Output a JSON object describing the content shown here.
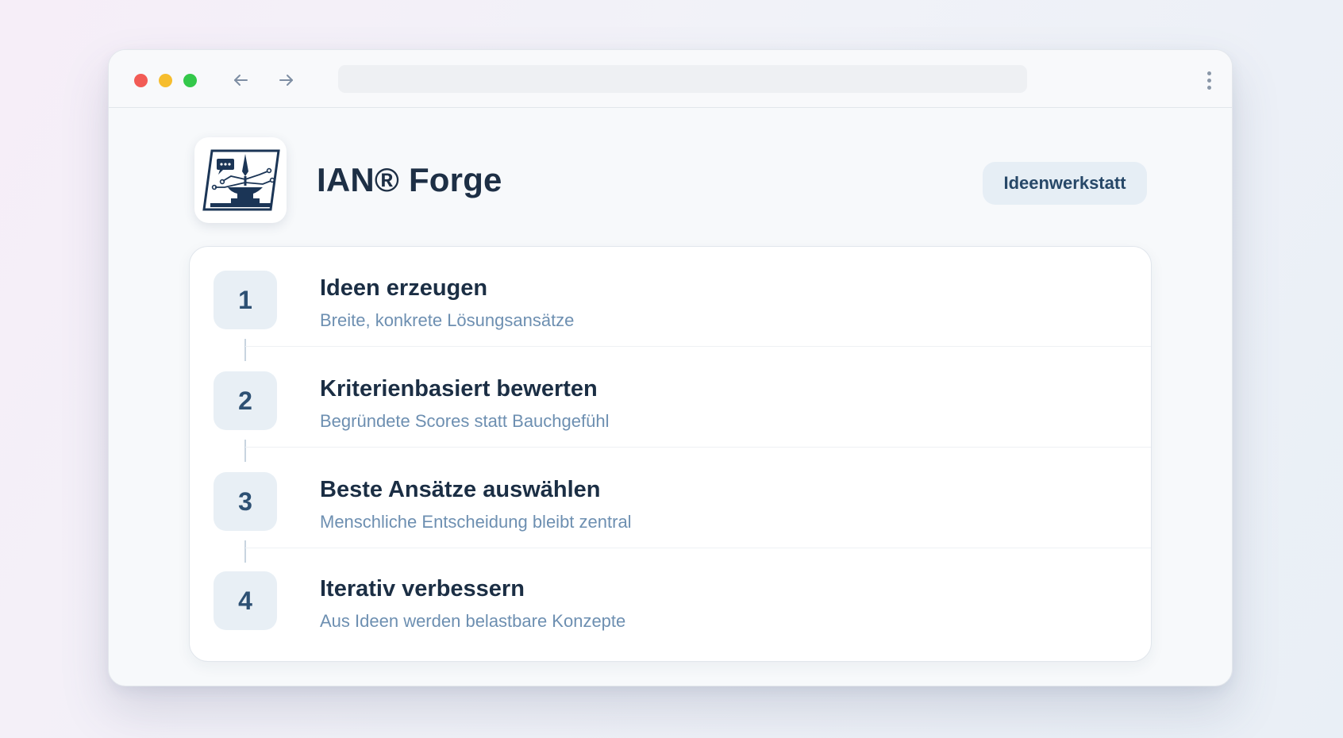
{
  "window": {
    "url": "",
    "controls": [
      "close",
      "minimize",
      "maximize"
    ]
  },
  "nav": {
    "back_icon": "arrow-left-icon",
    "forward_icon": "arrow-right-icon",
    "menu_icon": "kebab-menu-icon"
  },
  "header": {
    "logo_icon": "forge-anvil-circuit-logo",
    "title": "IAN® Forge",
    "tag": "Ideenwerkstatt"
  },
  "steps": [
    {
      "number": "1",
      "title": "Ideen erzeugen",
      "subtitle": "Breite, konkrete Lösungsansätze"
    },
    {
      "number": "2",
      "title": "Kriterienbasiert bewerten",
      "subtitle": "Begründete Scores statt Bauchgefühl"
    },
    {
      "number": "3",
      "title": "Beste Ansätze auswählen",
      "subtitle": "Menschliche Entscheidung bleibt zentral"
    },
    {
      "number": "4",
      "title": "Iterativ verbessern",
      "subtitle": "Aus Ideen werden belastbare Konzepte"
    }
  ],
  "colors": {
    "accent": "#1d2f45",
    "subtitle": "#6d8fb1",
    "badge_bg": "#e8eff5"
  }
}
